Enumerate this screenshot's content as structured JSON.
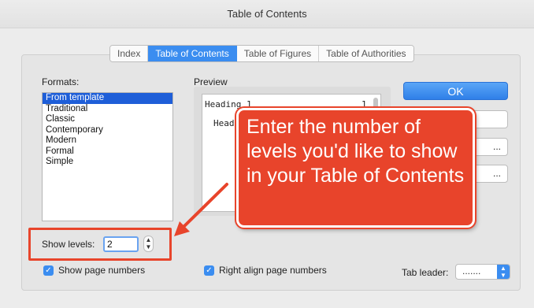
{
  "window": {
    "title": "Table of Contents"
  },
  "tabs": [
    {
      "label": "Index",
      "active": false
    },
    {
      "label": "Table of Contents",
      "active": true
    },
    {
      "label": "Table of Figures",
      "active": false
    },
    {
      "label": "Table of Authorities",
      "active": false
    }
  ],
  "formats": {
    "label": "Formats:",
    "items": [
      "From template",
      "Traditional",
      "Classic",
      "Contemporary",
      "Modern",
      "Formal",
      "Simple"
    ],
    "selected": "From template"
  },
  "preview": {
    "label": "Preview",
    "heading1": "Heading 1",
    "heading1_page": "1",
    "heading2": "Head"
  },
  "buttons": {
    "ok_label": "OK",
    "side_labels": [
      "",
      "...",
      "..."
    ]
  },
  "callout": {
    "text": "Enter the number of levels you'd like to show in your Table of Contents"
  },
  "levels": {
    "label": "Show levels:",
    "value": "2"
  },
  "options": {
    "show_page_numbers": {
      "label": "Show page numbers",
      "checked": true
    },
    "right_align": {
      "label": "Right align page numbers",
      "checked": true
    }
  },
  "tab_leader": {
    "label": "Tab leader:",
    "value": "......."
  },
  "colors": {
    "accent": "#3b8df0",
    "callout": "#e8442b"
  }
}
